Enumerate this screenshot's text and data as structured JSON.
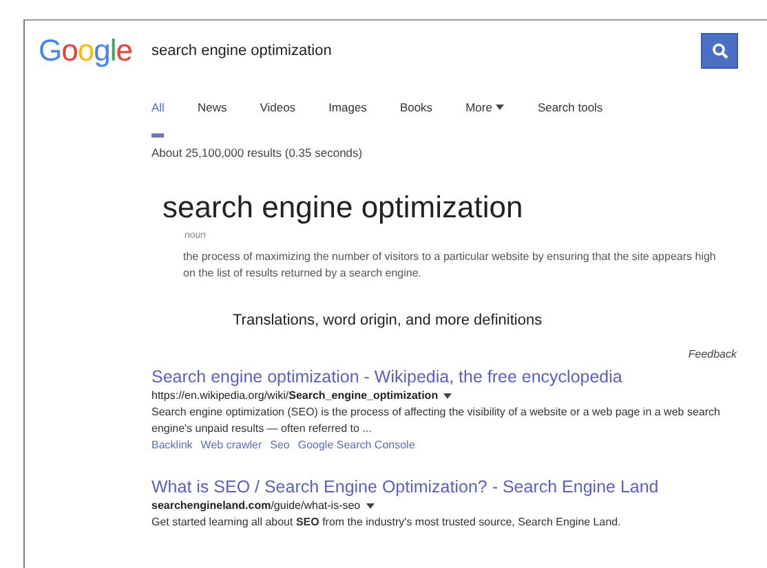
{
  "search": {
    "logo": [
      "G",
      "o",
      "o",
      "g",
      "l",
      "e"
    ],
    "query": "search engine optimization"
  },
  "tabs": [
    {
      "label": "All",
      "selected": true,
      "dropdown": false
    },
    {
      "label": "News",
      "selected": false,
      "dropdown": false
    },
    {
      "label": "Videos",
      "selected": false,
      "dropdown": false
    },
    {
      "label": "Images",
      "selected": false,
      "dropdown": false
    },
    {
      "label": "Books",
      "selected": false,
      "dropdown": false
    },
    {
      "label": "More",
      "selected": false,
      "dropdown": true
    },
    {
      "label": "Search tools",
      "selected": false,
      "dropdown": false
    }
  ],
  "result_stats": "About 25,100,000 results (0.35 seconds)",
  "definition": {
    "term": "search engine optimization",
    "part_of_speech": "noun",
    "meaning": "the process of maximizing the number of visitors to a particular website by ensuring that the site appears high on the list of results returned by a search engine.",
    "more": "Translations, word origin, and more definitions"
  },
  "feedback": "Feedback",
  "results": [
    {
      "title": "Search engine optimization - Wikipedia, the free encyclopedia",
      "url": "https://en.wikipedia.org/wiki/**Search_engine_optimization**",
      "snippet": "Search engine optimization (SEO) is the process of affecting the visibility of a website or a web page in a web search engine's unpaid results — often referred to ...",
      "sitelinks": [
        "Backlink",
        "Web crawler",
        "Seo",
        "Google Search Console"
      ]
    },
    {
      "title": "What is SEO / Search Engine Optimization? - Search Engine Land",
      "url": "**searchengineland.com**/guide/what-is-seo",
      "snippet": "Get started learning all about **SEO** from the industry's most trusted source, Search Engine Land."
    }
  ]
}
